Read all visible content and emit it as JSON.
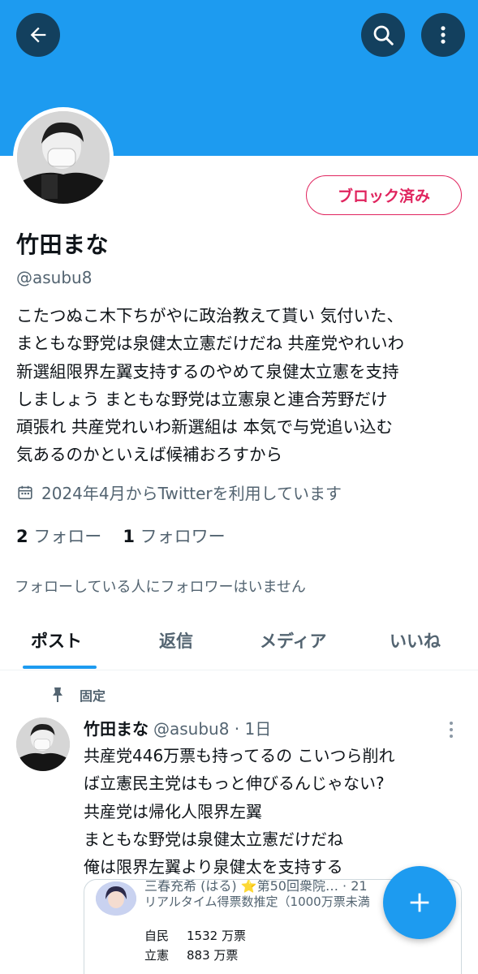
{
  "colors": {
    "accent": "#1d9bf0",
    "blocked": "#e0245e",
    "secondary_text": "#536471"
  },
  "header": {
    "back_icon": "arrow-left-icon",
    "search_icon": "search-icon",
    "more_icon": "more-vertical-icon"
  },
  "profile": {
    "display_name": "竹田まな",
    "handle": "@asubu8",
    "block_button_label": "ブロック済み",
    "bio": "こたつぬこ木下ちがやに政治教えて貰い 気付いた、\nまともな野党は泉健太立憲だけだね 共産党やれいわ\n新選組限界左翼支持するのやめて泉健太立憲を支持\nしましょう まともな野党は立憲泉と連合芳野だけ\n頑張れ 共産党れいわ新選組は 本気で与党追い込む\n気あるのかといえば候補おろすから",
    "joined_icon": "calendar-icon",
    "joined": "2024年4月からTwitterを利用しています",
    "following_count": "2",
    "following_label": "フォロー",
    "followers_count": "1",
    "followers_label": "フォロワー",
    "no_known_followers": "フォローしている人にフォロワーはいません"
  },
  "tabs": [
    {
      "label": "ポスト",
      "active": true
    },
    {
      "label": "返信",
      "active": false
    },
    {
      "label": "メディア",
      "active": false
    },
    {
      "label": "いいね",
      "active": false
    }
  ],
  "pinned_tweet": {
    "pinned_icon": "pin-icon",
    "pinned_label": "固定",
    "author_name": "竹田まな",
    "author_handle_time": "@asubu8 · 1日",
    "text": "共産党446万票も持ってるの こいつら削れ\nば立憲民主党はもっと伸びるんじゃない?\n共産党は帰化人限界左翼\nまともな野党は泉健太立憲だけだね\n俺は限界左翼より泉健太を支持する",
    "card": {
      "title": "三春充希 (はる) ⭐第50回衆院… · 21",
      "subtitle": "リアルタイム得票数推定（1000万票未満",
      "rows": [
        {
          "party": "自民",
          "votes": "1532 万票"
        },
        {
          "party": "立憲",
          "votes": "883 万票"
        }
      ]
    }
  },
  "fab": {
    "icon": "plus-icon"
  }
}
